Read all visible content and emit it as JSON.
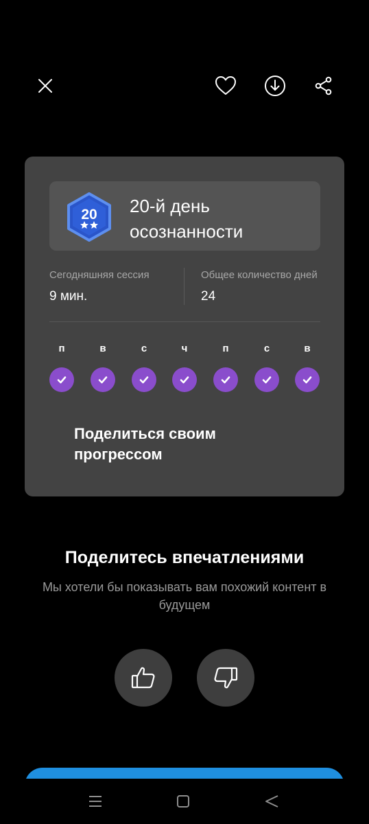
{
  "header": {
    "close_icon": "close-icon",
    "favorite_icon": "heart-icon",
    "download_icon": "download-icon",
    "share_icon": "share-icon"
  },
  "card": {
    "badge": {
      "number": "20",
      "icon": "badge-hexagon-icon",
      "color": "#2f5fd8"
    },
    "title": "20-й день осознанности",
    "stats": [
      {
        "label": "Сегодняшняя сессия",
        "value": "9 мин."
      },
      {
        "label": "Общее количество дней",
        "value": "24"
      }
    ],
    "week": [
      {
        "letter": "п",
        "done": true
      },
      {
        "letter": "в",
        "done": true
      },
      {
        "letter": "с",
        "done": true
      },
      {
        "letter": "ч",
        "done": true
      },
      {
        "letter": "п",
        "done": true
      },
      {
        "letter": "с",
        "done": true
      },
      {
        "letter": "в",
        "done": true
      }
    ],
    "share_text": "Поделиться своим прогрессом",
    "accent": "#8a4dcc"
  },
  "feedback": {
    "title": "Поделитесь впечатлениями",
    "subtitle": "Мы хотели бы показывать вам похожий контент в будущем",
    "like_icon": "thumbs-up-icon",
    "dislike_icon": "thumbs-down-icon"
  },
  "cta": {
    "color": "#1f8fe0"
  },
  "navbar": {
    "recent_icon": "recent-apps-icon",
    "home_icon": "home-icon",
    "back_icon": "back-icon"
  }
}
